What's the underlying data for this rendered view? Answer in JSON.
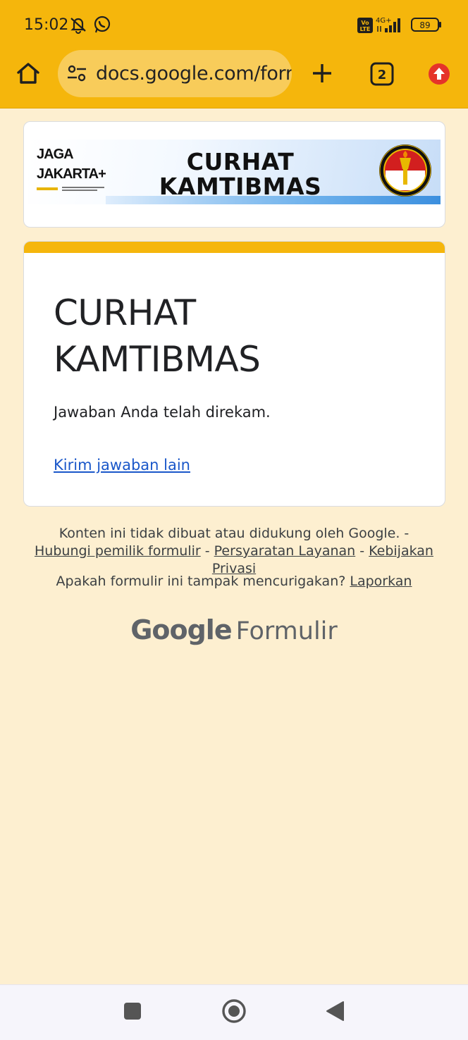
{
  "status_bar": {
    "time": "15:02",
    "network": "4G+",
    "volte": "Vo LTE",
    "battery": "89"
  },
  "browser": {
    "url": "docs.google.com/forms",
    "tab_count": "2"
  },
  "banner": {
    "logo_line1": "JAGA",
    "logo_line2": "JAKARTA+",
    "title_line1": "CURHAT",
    "title_line2": "KAMTIBMAS"
  },
  "form": {
    "title_line1": "CURHAT",
    "title_line2": "KAMTIBMAS",
    "message": "Jawaban Anda telah direkam.",
    "resend_link": "Kirim jawaban lain"
  },
  "footer": {
    "disclaimer": "Konten ini tidak dibuat atau didukung oleh Google. - ",
    "contact_owner": "Hubungi pemilik formulir",
    "sep1": " - ",
    "terms": "Persyaratan Layanan",
    "sep2": " - ",
    "privacy": "Kebijakan Privasi",
    "suspicious": "Apakah formulir ini tampak mencurigakan? ",
    "report": "Laporkan",
    "brand_google": "Google",
    "brand_product": "Formulir"
  },
  "colors": {
    "toolbar": "#f5b60c",
    "page_bg": "#fdefd0",
    "link": "#1a57c9",
    "accent": "#f5b60c"
  },
  "icons": [
    "home-icon",
    "site-settings-icon",
    "new-tab-icon",
    "tab-switcher-icon",
    "update-icon",
    "mute-icon",
    "whatsapp-icon",
    "signal-icon",
    "battery-icon",
    "recents-icon",
    "home-nav-icon",
    "back-icon"
  ]
}
